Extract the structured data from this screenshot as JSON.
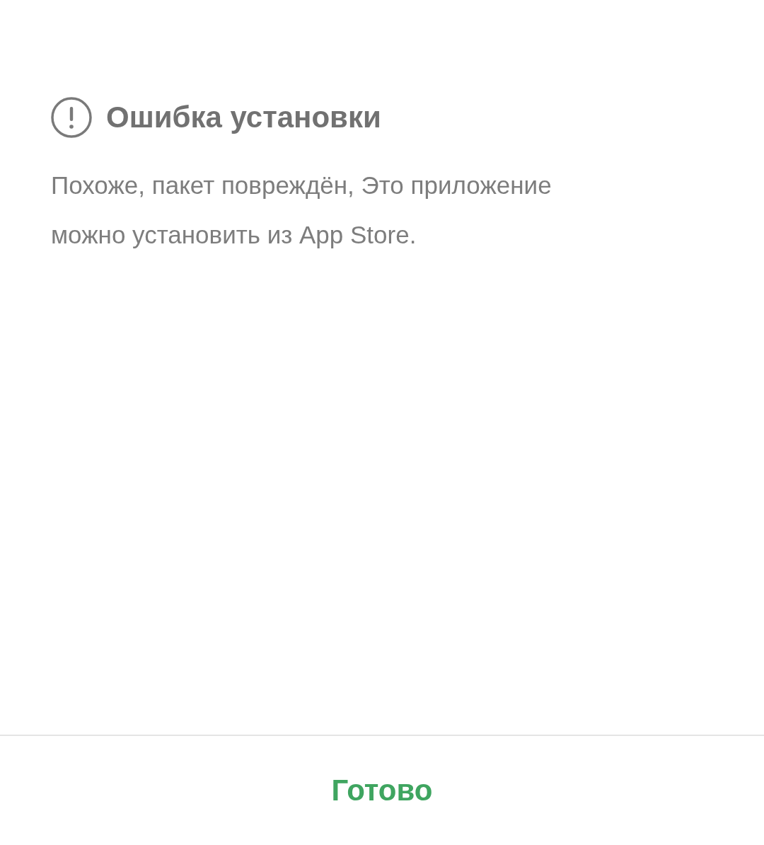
{
  "dialog": {
    "title": "Ошибка установки",
    "message": "Похоже, пакет повреждён, Это приложение можно установить из App Store.",
    "buttons": [
      "Готово"
    ]
  }
}
